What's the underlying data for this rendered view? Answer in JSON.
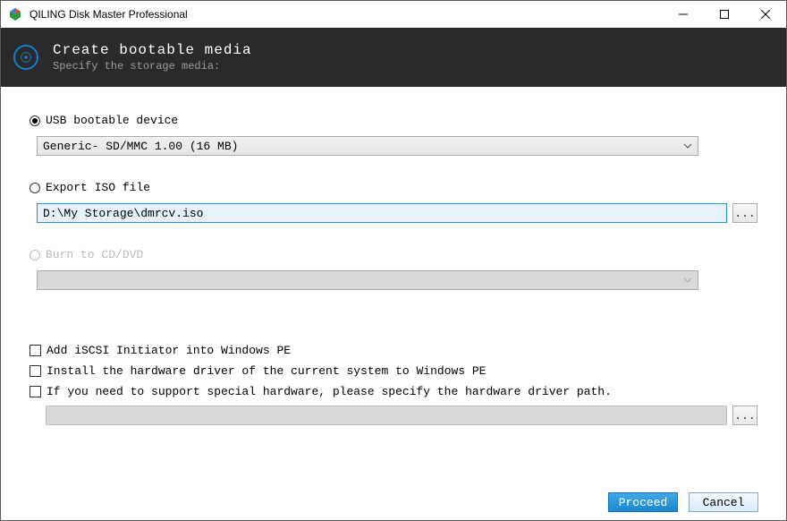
{
  "window": {
    "title": "QILING Disk Master Professional"
  },
  "header": {
    "title": "Create bootable media",
    "subtitle": "Specify the storage media:"
  },
  "options": {
    "usb": {
      "label": "USB bootable device",
      "selected_value": "Generic- SD/MMC 1.00 (16 MB)"
    },
    "iso": {
      "label": "Export ISO file",
      "path": "D:\\My Storage\\dmrcv.iso"
    },
    "cd": {
      "label": "Burn to CD/DVD"
    }
  },
  "checkboxes": {
    "iscsi": "Add iSCSI Initiator into Windows PE",
    "driver_current": "Install the hardware driver of the current system to Windows PE",
    "driver_path": "If you need to support special hardware, please specify the hardware driver path."
  },
  "buttons": {
    "browse": "...",
    "proceed": "Proceed",
    "cancel": "Cancel"
  }
}
